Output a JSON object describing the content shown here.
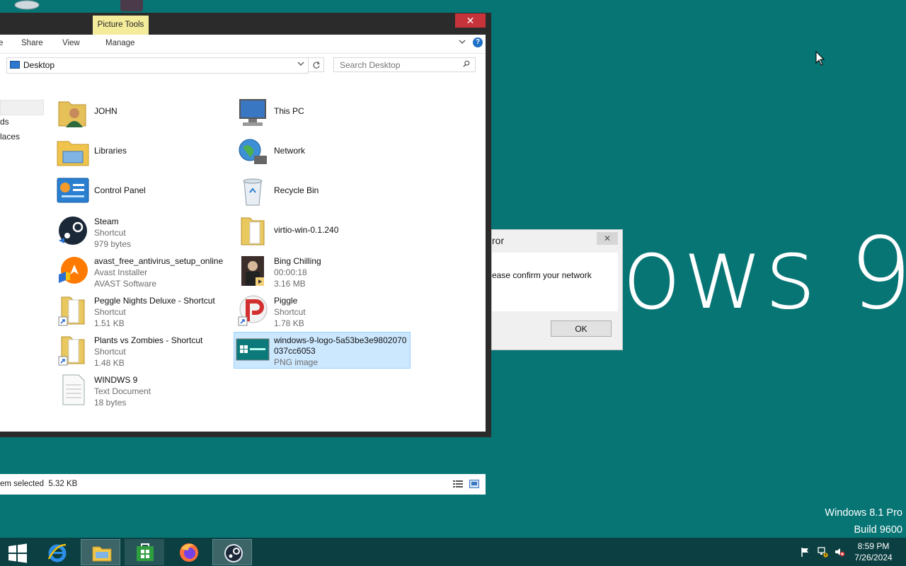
{
  "desktop": {
    "wallpaper_text": "ows 9",
    "watermark_line1": "Windows 8.1 Pro",
    "watermark_line2": "Build 9600"
  },
  "explorer": {
    "contextual_tab": "Picture Tools",
    "close_glyph": "✕",
    "ribbon_tabs": [
      "e",
      "Share",
      "View",
      "Manage"
    ],
    "address": "Desktop",
    "search_placeholder": "Search Desktop",
    "nav_items": [
      "ds",
      "laces"
    ],
    "items": [
      {
        "name": "JOHN",
        "icon": "user-folder-icon"
      },
      {
        "name": "This PC",
        "icon": "computer-icon"
      },
      {
        "name": "Libraries",
        "icon": "libraries-icon"
      },
      {
        "name": "Network",
        "icon": "network-icon"
      },
      {
        "name": "Control Panel",
        "icon": "control-panel-icon"
      },
      {
        "name": "Recycle Bin",
        "icon": "recycle-bin-icon"
      },
      {
        "name": "Steam",
        "line1": "Shortcut",
        "line2": "979 bytes",
        "icon": "steam-icon"
      },
      {
        "name": "virtio-win-0.1.240",
        "icon": "folder-icon"
      },
      {
        "name": "avast_free_antivirus_setup_online",
        "line1": "Avast Installer",
        "line2": "AVAST Software",
        "icon": "avast-icon"
      },
      {
        "name": "Bing Chilling",
        "line1": "00:00:18",
        "line2": "3.16 MB",
        "icon": "video-icon"
      },
      {
        "name": "Peggle Nights Deluxe - Shortcut",
        "line1": "Shortcut",
        "line2": "1.51 KB",
        "icon": "shortcut-folder-icon"
      },
      {
        "name": "Piggle",
        "line1": "Shortcut",
        "line2": "1.78 KB",
        "icon": "piggle-icon"
      },
      {
        "name": "Plants vs Zombies - Shortcut",
        "line1": "Shortcut",
        "line2": "1.48 KB",
        "icon": "shortcut-folder-icon"
      },
      {
        "name": "windows-9-logo-5a53be3e9802070",
        "name2": "037cc6053",
        "line1": "PNG image",
        "icon": "image-icon"
      },
      {
        "name": "WINDWS 9",
        "line1": "Text Document",
        "line2": "18 bytes",
        "icon": "text-document-icon"
      }
    ],
    "status": "em selected  5.32 KB"
  },
  "dialog": {
    "title": "ror",
    "close_glyph": "✕",
    "message": "ease confirm your network",
    "ok": "OK"
  },
  "taskbar": {
    "apps": [
      "start",
      "internet-explorer",
      "file-explorer",
      "store",
      "firefox",
      "steam"
    ],
    "time": "8:59 PM",
    "date": "7/26/2024"
  },
  "colors": {
    "desktop": "#087575",
    "taskbar": "#0b3f41",
    "selection": "#cce8ff",
    "close": "#c7333a"
  }
}
